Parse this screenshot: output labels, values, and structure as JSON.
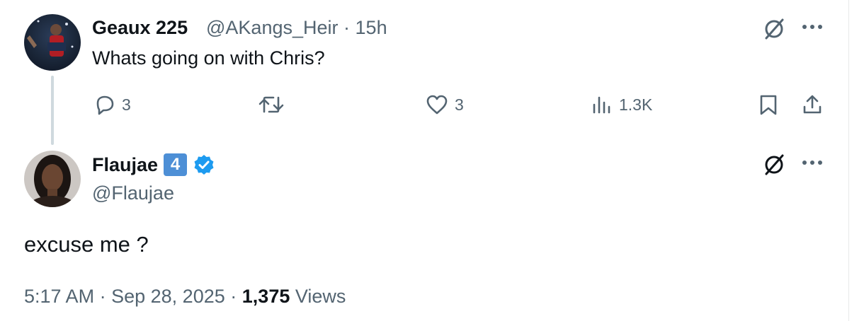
{
  "reply": {
    "display_name": "Geaux 225",
    "handle": "@AKangs_Heir",
    "separator": "·",
    "time": "15h",
    "text": "Whats going on with Chris?",
    "actions": {
      "reply_count": "3",
      "retweet_count": "",
      "like_count": "3",
      "views_count": "1.3K"
    }
  },
  "tweet": {
    "display_name": "Flaujae",
    "badge_number": "4",
    "handle": "@Flaujae",
    "text": "excuse me ?",
    "time": "5:17 AM",
    "separator": "·",
    "date": "Sep 28, 2025",
    "views_count": "1,375",
    "views_label": "Views"
  },
  "colors": {
    "text_primary": "#0f1419",
    "text_secondary": "#536471",
    "verified_blue": "#1d9bf0",
    "badge_blue": "#4d8fd6",
    "thread_line": "#cfd9de"
  },
  "icons": [
    "reply-icon",
    "retweet-icon",
    "like-icon",
    "views-icon",
    "bookmark-icon",
    "share-icon",
    "grok-icon",
    "more-icon",
    "verified-icon"
  ]
}
